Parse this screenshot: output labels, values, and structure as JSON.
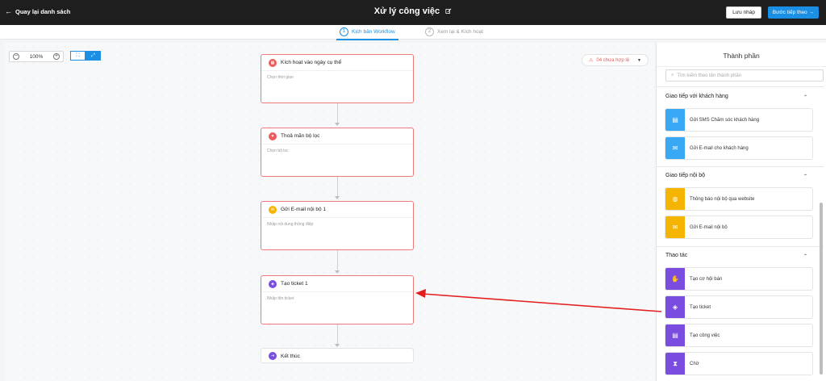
{
  "topbar": {
    "back_label": "Quay lại danh sách",
    "title": "Xử lý công việc",
    "draft_label": "Lưu nháp",
    "next_label": "Bước tiếp theo"
  },
  "steps": [
    {
      "num": "1",
      "label": "Kịch bản Workflow"
    },
    {
      "num": "2",
      "label": "Xem lại & Kích hoạt"
    }
  ],
  "toolbar": {
    "zoom": "100%",
    "minus": "−",
    "plus": "+"
  },
  "invalid": {
    "label": "04 chưa hợp lệ"
  },
  "nodes": [
    {
      "title": "Kích hoạt vào ngày cụ thể",
      "body": "Chọn thời gian",
      "icon_color": "#ef5b5b",
      "icon": "calendar-icon"
    },
    {
      "title": "Thoả mãn bộ lọc",
      "body": "Chọn bộ lọc",
      "icon_color": "#ef5b5b",
      "icon": "filter-icon"
    },
    {
      "title": "Gửi E-mail nội bộ 1",
      "body": "Nhập nội dung thông điệp",
      "icon_color": "#f5b400",
      "icon": "mail-icon"
    },
    {
      "title": "Tạo ticket 1",
      "body": "Nhập tên ticket",
      "icon_color": "#7a4de0",
      "icon": "ticket-icon"
    },
    {
      "title": "Kết thúc",
      "body": "",
      "icon_color": "#7a4de0",
      "icon": "exit-icon"
    }
  ],
  "panel": {
    "title": "Thành phần",
    "search_placeholder": "Tìm kiếm theo tên thành phần",
    "sections": [
      {
        "title": "Giao tiếp với khách hàng",
        "items": [
          {
            "label": "Gửi SMS Chăm sóc khách hàng",
            "color": "#3aa9f5",
            "icon": "sms-icon"
          },
          {
            "label": "Gửi E-mail cho khách hàng",
            "color": "#3aa9f5",
            "icon": "mail-icon"
          }
        ]
      },
      {
        "title": "Giao tiếp nội bộ",
        "items": [
          {
            "label": "Thông báo nội bộ qua website",
            "color": "#f5b400",
            "icon": "globe-icon"
          },
          {
            "label": "Gửi E-mail nội bộ",
            "color": "#f5b400",
            "icon": "mail-icon"
          }
        ]
      },
      {
        "title": "Thao tác",
        "items": [
          {
            "label": "Tạo cơ hội bán",
            "color": "#7a4de0",
            "icon": "handshake-icon"
          },
          {
            "label": "Tạo ticket",
            "color": "#7a4de0",
            "icon": "ticket-icon"
          },
          {
            "label": "Tạo công việc",
            "color": "#7a4de0",
            "icon": "task-icon"
          },
          {
            "label": "Chờ",
            "color": "#7a4de0",
            "icon": "hourglass-icon"
          }
        ]
      }
    ]
  }
}
